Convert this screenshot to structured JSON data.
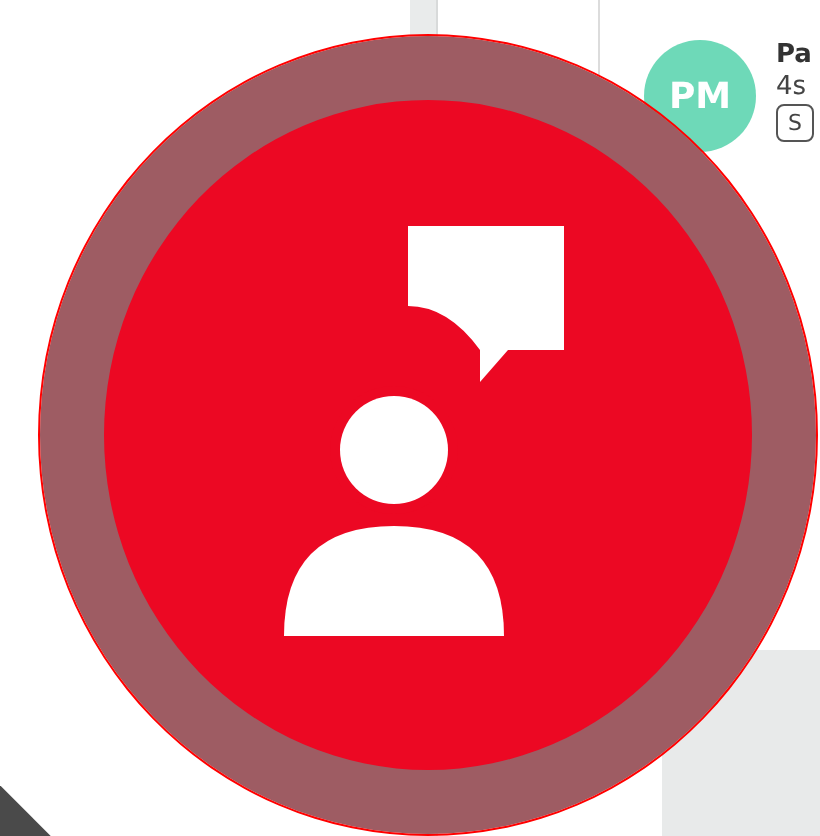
{
  "contact": {
    "initials": "PM",
    "name": "Pa",
    "detail": "4s",
    "action": "S"
  }
}
